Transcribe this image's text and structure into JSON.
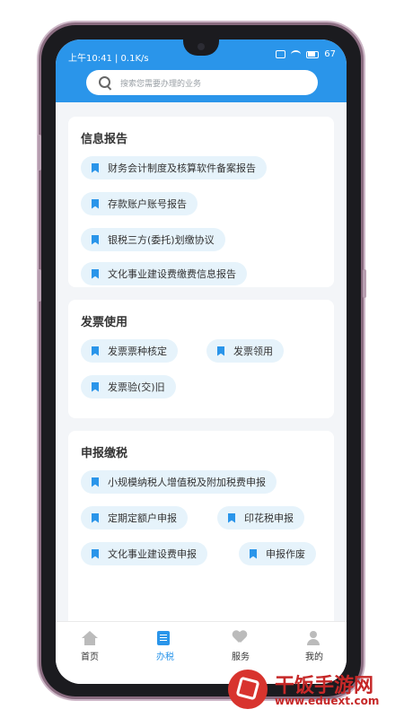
{
  "status": {
    "time": "上午10:41 | 0.1K/s",
    "battery": "67"
  },
  "search": {
    "placeholder": "搜索您需要办理的业务"
  },
  "sections": [
    {
      "title": "信息报告",
      "items": [
        "财务会计制度及核算软件备案报告",
        "存款账户账号报告",
        "银税三方(委托)划缴协议",
        "文化事业建设费缴费信息报告"
      ]
    },
    {
      "title": "发票使用",
      "items": [
        "发票票种核定",
        "发票领用",
        "发票验(交)旧"
      ]
    },
    {
      "title": "申报缴税",
      "items": [
        "小规模纳税人增值税及附加税费申报",
        "定期定额户申报",
        "印花税申报",
        "文化事业建设费申报",
        "申报作废"
      ]
    }
  ],
  "tabs": [
    "首页",
    "办税",
    "服务",
    "我的"
  ],
  "logo": {
    "title": "干饭手游网",
    "url": "www.eduext.com"
  },
  "colors": {
    "accent": "#2a95ea"
  }
}
